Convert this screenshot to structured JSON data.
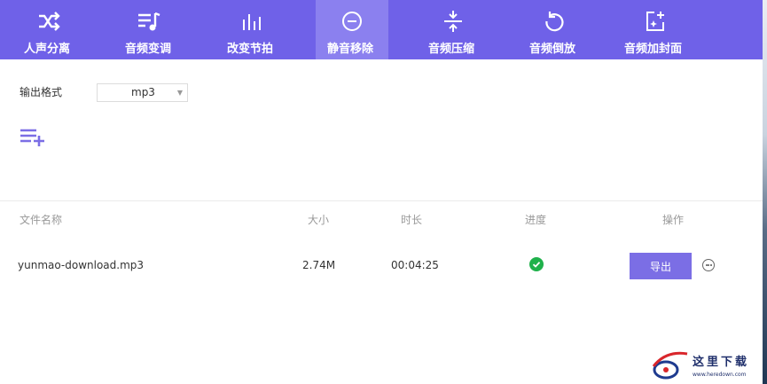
{
  "toolbar": {
    "tools": [
      {
        "label": "人声分离",
        "icon": "shuffle-icon"
      },
      {
        "label": "音频变调",
        "icon": "music-list-icon"
      },
      {
        "label": "改变节拍",
        "icon": "equalizer-bars-icon"
      },
      {
        "label": "静音移除",
        "icon": "minus-circle-icon",
        "active": true
      },
      {
        "label": "音频压缩",
        "icon": "compress-icon"
      },
      {
        "label": "音频倒放",
        "icon": "rewind-icon"
      },
      {
        "label": "音频加封面",
        "icon": "image-sparkle-icon"
      }
    ]
  },
  "settings": {
    "format_label": "输出格式",
    "format_value": "mp3"
  },
  "table": {
    "headers": [
      "文件名称",
      "大小",
      "时长",
      "进度",
      "操作"
    ],
    "rows": [
      {
        "name": "yunmao-download.mp3",
        "size": "2.74M",
        "duration": "00:04:25",
        "progress": "done",
        "action": "导出"
      }
    ]
  },
  "watermark": {
    "title": "这里下载",
    "url": "www.heredown.com"
  },
  "colors": {
    "toolbar": "#6f61e8",
    "toolbar_active": "#8b80ef",
    "accent": "#7b6ee5",
    "success": "#1fb14b"
  }
}
